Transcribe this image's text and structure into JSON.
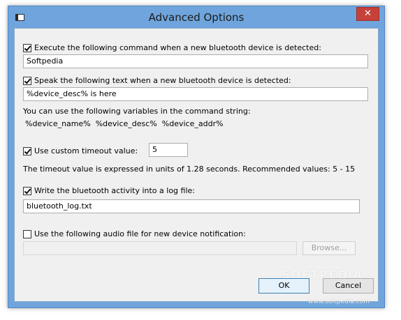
{
  "window": {
    "title": "Advanced Options",
    "close_label": "✕"
  },
  "options": {
    "execute_command": {
      "checked": true,
      "label": "Execute the following command when a new bluetooth device is detected:",
      "value": "Softpedia"
    },
    "speak_text": {
      "checked": true,
      "label": "Speak the following text when a new bluetooth device is detected:",
      "value": "%device_desc% is here"
    },
    "variables_hint": "You can use the following variables in the command string:",
    "variables": "%device_name%  %device_desc%  %device_addr%",
    "custom_timeout": {
      "checked": true,
      "label": "Use custom timeout value:",
      "value": "5"
    },
    "timeout_hint": "The timeout value is expressed in units of 1.28 seconds. Recommended values: 5 - 15",
    "log_file": {
      "checked": true,
      "label": "Write the bluetooth activity into a log file:",
      "value": "bluetooth_log.txt"
    },
    "audio_file": {
      "checked": false,
      "label": "Use the following audio file for new device notification:",
      "value": "",
      "browse_label": "Browse..."
    }
  },
  "buttons": {
    "ok": "OK",
    "cancel": "Cancel"
  },
  "watermark": {
    "text": "SOFTPEDIA",
    "url": "www.softpedia.com"
  }
}
